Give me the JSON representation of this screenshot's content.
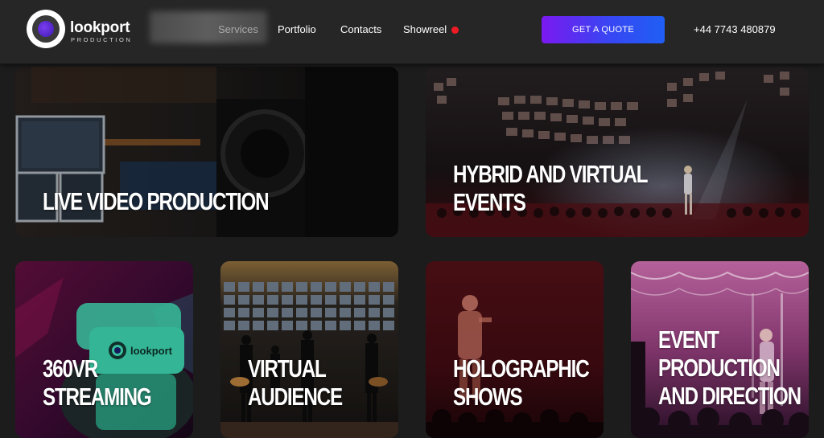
{
  "brand": {
    "name": "lookport",
    "sub": "PRODUCTION"
  },
  "nav": {
    "items": [
      {
        "label": "Services",
        "active": true
      },
      {
        "label": "Portfolio",
        "active": false
      },
      {
        "label": "Contacts",
        "active": false
      },
      {
        "label": "Showreel",
        "active": false,
        "indicator": "red-dot"
      }
    ]
  },
  "cta": {
    "label": "GET A QUOTE",
    "gradient": [
      "#7a19f0",
      "#1f5ff5"
    ]
  },
  "phone": "+44 7743 480879",
  "colors": {
    "header_bg": "#262626",
    "page_bg": "#1c1c1c",
    "indicator_red": "#ee1b24"
  },
  "services": [
    {
      "title_lines": [
        "LIVE VIDEO PRODUCTION"
      ]
    },
    {
      "title_lines": [
        "HYBRID AND VIRTUAL",
        "EVENTS"
      ]
    },
    {
      "title_lines": [
        "360VR",
        "STREAMING"
      ],
      "headset_label": "lookport"
    },
    {
      "title_lines": [
        "VIRTUAL",
        "AUDIENCE"
      ]
    },
    {
      "title_lines": [
        "HOLOGRAPHIC",
        "SHOWS"
      ]
    },
    {
      "title_lines": [
        "EVENT",
        "PRODUCTION",
        "AND DIRECTION"
      ]
    }
  ]
}
